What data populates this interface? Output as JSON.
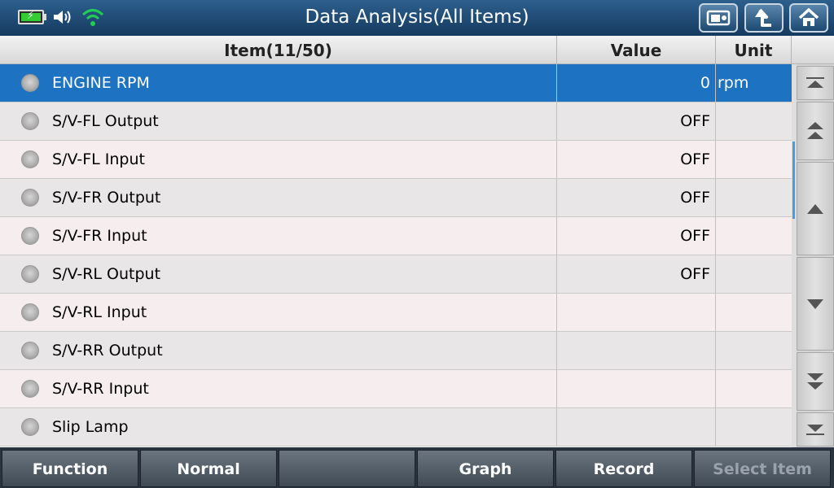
{
  "header": {
    "title": "Data Analysis(All Items)"
  },
  "table": {
    "columns": {
      "item": "Item(11/50)",
      "value": "Value",
      "unit": "Unit"
    },
    "rows": [
      {
        "item": "ENGINE RPM",
        "value": "0",
        "unit": "rpm",
        "selected": true
      },
      {
        "item": "S/V-FL Output",
        "value": "OFF",
        "unit": ""
      },
      {
        "item": "S/V-FL Input",
        "value": "OFF",
        "unit": ""
      },
      {
        "item": "S/V-FR Output",
        "value": "OFF",
        "unit": ""
      },
      {
        "item": "S/V-FR Input",
        "value": "OFF",
        "unit": ""
      },
      {
        "item": "S/V-RL Output",
        "value": "OFF",
        "unit": ""
      },
      {
        "item": "S/V-RL Input",
        "value": "",
        "unit": ""
      },
      {
        "item": "S/V-RR Output",
        "value": "",
        "unit": ""
      },
      {
        "item": "S/V-RR Input",
        "value": "",
        "unit": ""
      },
      {
        "item": "Slip Lamp",
        "value": "",
        "unit": ""
      }
    ]
  },
  "footer": {
    "buttons": [
      {
        "label": "Function",
        "enabled": true
      },
      {
        "label": "Normal",
        "enabled": true
      },
      {
        "label": "",
        "enabled": true
      },
      {
        "label": "Graph",
        "enabled": true
      },
      {
        "label": "Record",
        "enabled": true
      },
      {
        "label": "Select Item",
        "enabled": false
      }
    ]
  },
  "colors": {
    "selected_row": "#1d72c1",
    "topbar": "#1f4a74",
    "battery": "#33cc33",
    "wifi": "#22cc55"
  },
  "icons": [
    "battery-icon",
    "speaker-icon",
    "wifi-icon",
    "capture-icon",
    "back-icon",
    "home-icon"
  ]
}
